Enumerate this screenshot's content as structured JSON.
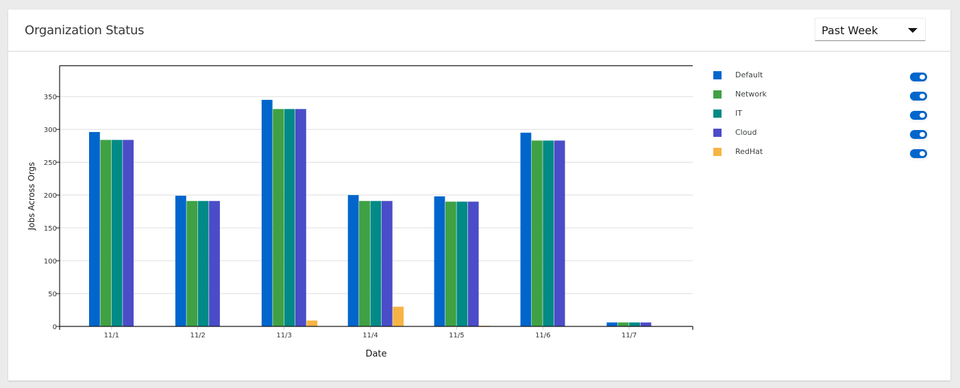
{
  "card": {
    "title": "Organization Status",
    "period_select": {
      "selected": "Past Week"
    }
  },
  "chart_data": {
    "type": "bar",
    "title": "",
    "xlabel": "Date",
    "ylabel": "Jobs Across Orgs",
    "categories": [
      "11/1",
      "11/2",
      "11/3",
      "11/4",
      "11/5",
      "11/6",
      "11/7"
    ],
    "ylim": [
      0,
      397
    ],
    "yticks": [
      0,
      50,
      100,
      150,
      200,
      250,
      300,
      350
    ],
    "grid": true,
    "legend_position": "right",
    "series": [
      {
        "name": "Default",
        "color": "#0066cc",
        "enabled": true,
        "values": [
          296,
          199,
          345,
          200,
          198,
          295,
          6
        ]
      },
      {
        "name": "Network",
        "color": "#3fa143",
        "enabled": true,
        "values": [
          284,
          191,
          331,
          191,
          190,
          283,
          6
        ]
      },
      {
        "name": "IT",
        "color": "#018a86",
        "enabled": true,
        "values": [
          284,
          191,
          331,
          191,
          190,
          283,
          6
        ]
      },
      {
        "name": "Cloud",
        "color": "#4b4cc8",
        "enabled": true,
        "values": [
          284,
          191,
          331,
          191,
          190,
          283,
          6
        ]
      },
      {
        "name": "RedHat",
        "color": "#f7b445",
        "enabled": true,
        "values": [
          0,
          0,
          9,
          30,
          1,
          0,
          0
        ]
      }
    ]
  }
}
